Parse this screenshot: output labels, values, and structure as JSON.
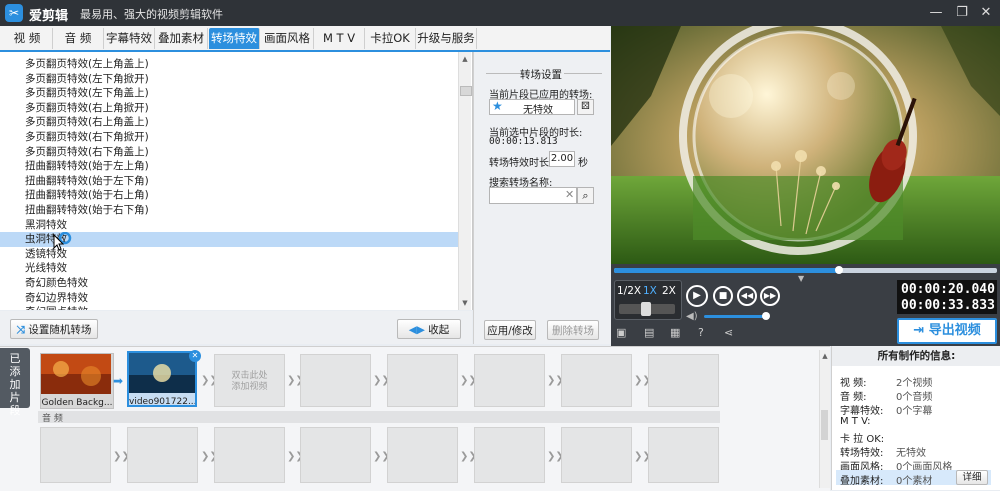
{
  "titlebar": {
    "app_name": "爱剪辑",
    "slogan": "最易用、强大的视频剪辑软件",
    "logo_glyph": "✂",
    "win_minimize": "—",
    "win_restore": "❐",
    "win_close": "✕"
  },
  "tabs": [
    {
      "label": "视 频"
    },
    {
      "label": "音 频"
    },
    {
      "label": "字幕特效"
    },
    {
      "label": "叠加素材"
    },
    {
      "label": "转场特效"
    },
    {
      "label": "画面风格"
    },
    {
      "label": "M T V"
    },
    {
      "label": "卡拉OK"
    },
    {
      "label": "升级与服务"
    }
  ],
  "transitions": {
    "items": [
      "多页翻页特效(左上角盖上)",
      "多页翻页特效(左下角掀开)",
      "多页翻页特效(左下角盖上)",
      "多页翻页特效(右上角掀开)",
      "多页翻页特效(右上角盖上)",
      "多页翻页特效(右下角掀开)",
      "多页翻页特效(右下角盖上)",
      "扭曲翻转特效(始于左上角)",
      "扭曲翻转特效(始于左下角)",
      "扭曲翻转特效(始于右上角)",
      "扭曲翻转特效(始于右下角)",
      "黑洞特效",
      "虫洞特效",
      "透镜特效",
      "光线特效",
      "奇幻颜色特效",
      "奇幻边界特效",
      "奇幻圆点特效"
    ],
    "selected_index": 12,
    "random_button": "设置随机转场",
    "collapse_button": "收起"
  },
  "settings": {
    "title": "转场设置",
    "applied_label": "当前片段已应用的转场:",
    "applied_value": "无特效",
    "duration_label": "当前选中片段的时长:",
    "duration_value": "00:00:13.813",
    "effect_duration_label": "转场特效时长:",
    "effect_duration_value": "2.00",
    "effect_duration_unit": "秒",
    "search_label": "搜索转场名称:",
    "search_value": "",
    "apply_button": "应用/修改",
    "delete_button": "删除转场"
  },
  "player": {
    "speeds": [
      "1/2X",
      "1X",
      "2X"
    ],
    "active_speed": "1X",
    "current_time": "00:00:20.040",
    "total_time": "00:00:33.833",
    "progress": 0.59,
    "volume": 0.85,
    "export_button": "导出视频"
  },
  "timeline": {
    "tab_label": "已添加片段",
    "clips": [
      {
        "name": "Golden Backg...",
        "selected": false
      },
      {
        "name": "video901722....",
        "selected": true
      }
    ],
    "add_hint_1": "双击此处",
    "add_hint_2": "添加视频",
    "audio_label": "音 频"
  },
  "info": {
    "title": "所有制作的信息:",
    "rows": [
      {
        "k": "视    频:",
        "v": "2个视频"
      },
      {
        "k": "音    频:",
        "v": "0个音频"
      },
      {
        "k": "字幕特效:",
        "v": "0个字幕"
      },
      {
        "k": "M  T  V:",
        "v": ""
      },
      {
        "k": "卡 拉 OK:",
        "v": ""
      },
      {
        "k": "转场特效:",
        "v": "无特效"
      },
      {
        "k": "画面风格:",
        "v": "0个画面风格"
      },
      {
        "k": "叠加素材:",
        "v": "0个素材"
      }
    ],
    "detail_button": "详细"
  },
  "colors": {
    "accent": "#2c8fde",
    "titlebar": "#2f3338",
    "selection": "#bcd9f7"
  }
}
